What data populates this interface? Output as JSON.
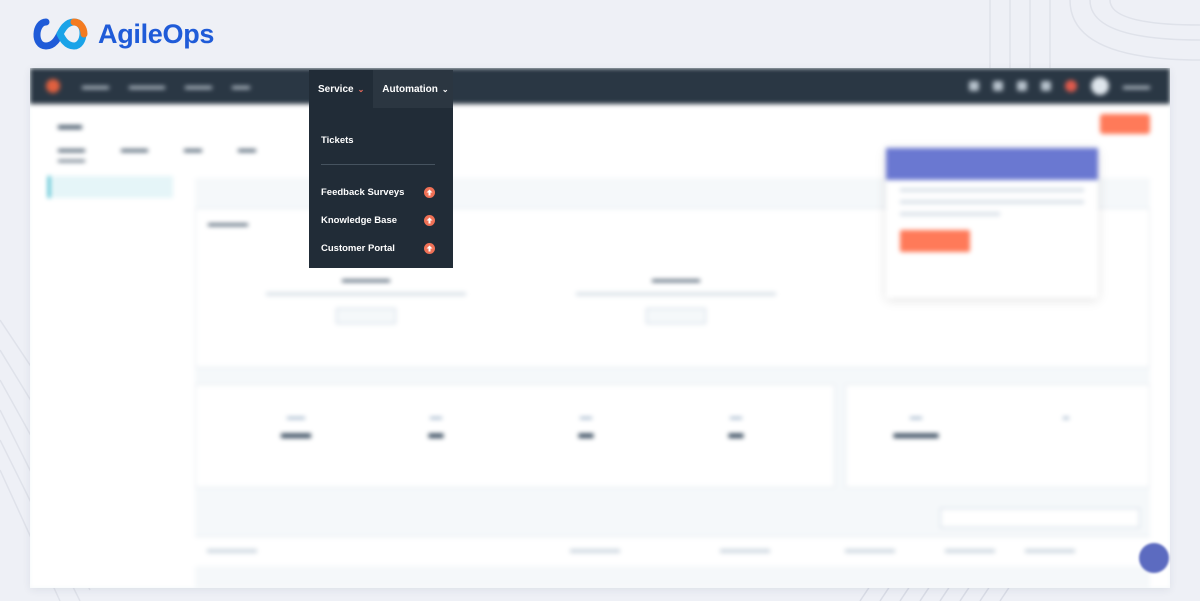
{
  "brand": {
    "name": "AgileOps",
    "colors": {
      "blue": "#1f5bd8",
      "cyan": "#1aa3e8",
      "orange": "#f47b20"
    }
  },
  "menubar": {
    "tabs": [
      {
        "label": "Service",
        "icon": "chevron-down-icon",
        "active": true
      },
      {
        "label": "Automation",
        "icon": "chevron-down-icon",
        "active": false
      }
    ]
  },
  "dropdown": {
    "items": [
      {
        "label": "Tickets",
        "badge": null
      },
      {
        "label": "Feedback Surveys",
        "badge": "upgrade-arrow-icon"
      },
      {
        "label": "Knowledge Base",
        "badge": "upgrade-arrow-icon"
      },
      {
        "label": "Customer Portal",
        "badge": "upgrade-arrow-icon"
      }
    ]
  },
  "colors": {
    "menu_bg": "#2b3641",
    "dropdown_bg": "#212c37",
    "upgrade_badge": "#f07156",
    "accent_caret": "#f06b5c"
  }
}
